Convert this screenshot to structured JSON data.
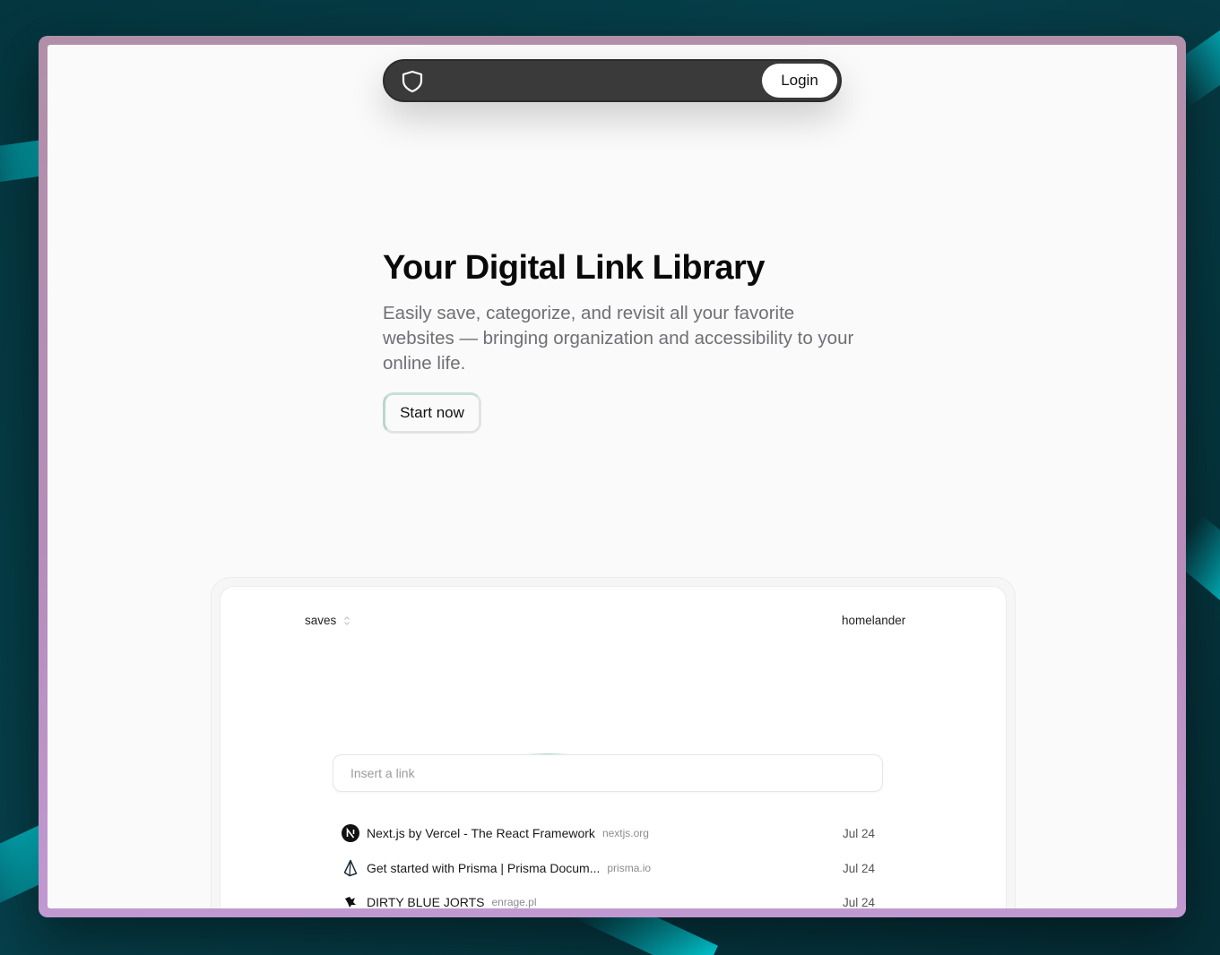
{
  "nav": {
    "login_label": "Login"
  },
  "hero": {
    "title": "Your Digital Link Library",
    "subtitle": "Easily save, categorize, and revisit all your favorite websites — bringing organization and accessibility to your online life.",
    "cta_label": "Start now"
  },
  "preview": {
    "collection_label": "saves",
    "username": "homelander",
    "input_placeholder": "Insert a link",
    "links": [
      {
        "icon": "nextjs-icon",
        "title": "Next.js by Vercel - The React Framework",
        "domain": "nextjs.org",
        "date": "Jul 24"
      },
      {
        "icon": "prisma-icon",
        "title": "Get started with Prisma | Prisma Docum...",
        "domain": "prisma.io",
        "date": "Jul 24"
      },
      {
        "icon": "dragon-icon",
        "title": "DIRTY BLUE JORTS",
        "domain": "enrage.pl",
        "date": "Jul 24"
      }
    ]
  },
  "colors": {
    "navbar": "#3a3a3b",
    "window_frame": "#b68dbb",
    "page_bg": "#fafafa",
    "desktop": "#04363f",
    "accent_streak": "#00e0ea"
  }
}
